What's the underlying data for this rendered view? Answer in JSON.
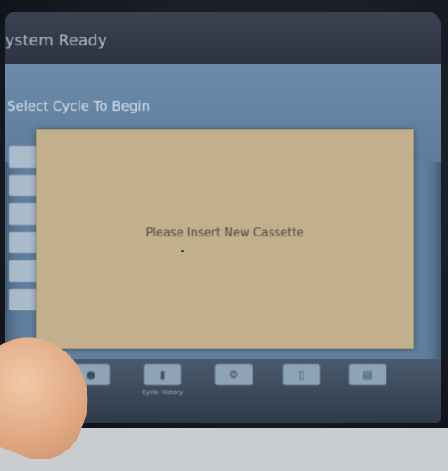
{
  "header": {
    "title": "ystem Ready"
  },
  "main": {
    "prompt": "Select Cycle To Begin",
    "dialog": {
      "message": "Please Insert New Cassette"
    }
  },
  "toolbar": {
    "items": [
      {
        "icon": "user-icon",
        "label": ""
      },
      {
        "icon": "chart-icon",
        "label": "Cycle History"
      },
      {
        "icon": "settings-icon",
        "label": ""
      },
      {
        "icon": "door-icon",
        "label": ""
      },
      {
        "icon": "print-icon",
        "label": ""
      }
    ]
  },
  "colors": {
    "screen": "#5e7f9e",
    "title_bar": "#2e3441",
    "dialog": "#c2af8b",
    "bottom_bar": "#3a4656"
  }
}
